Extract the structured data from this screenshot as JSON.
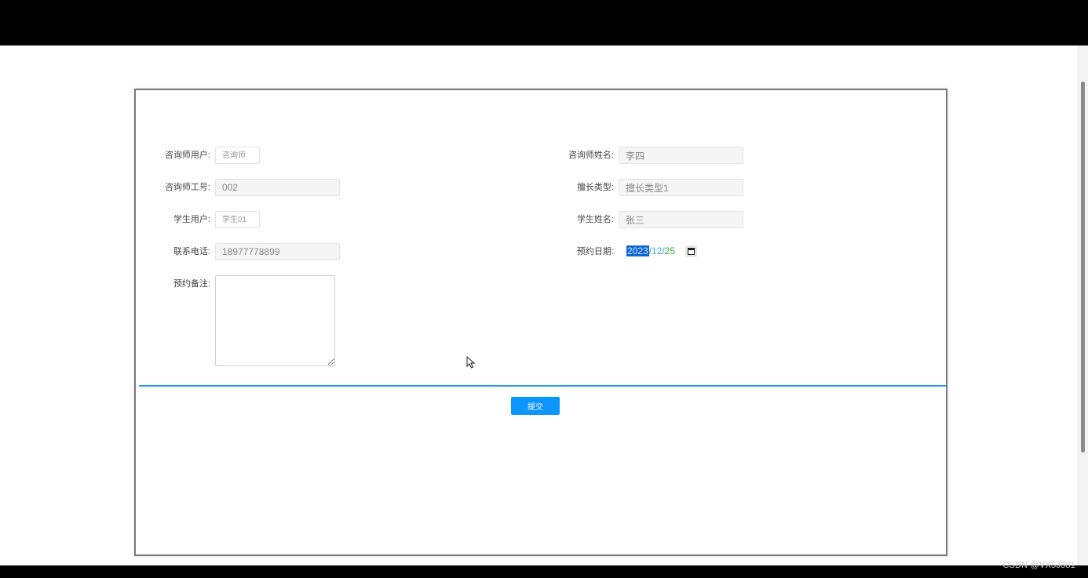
{
  "form": {
    "counselor_user": {
      "label": "咨询师用户:",
      "placeholder": "咨询师"
    },
    "counselor_name": {
      "label": "咨询师姓名:",
      "value": "李四"
    },
    "counselor_id": {
      "label": "咨询师工号:",
      "value": "002"
    },
    "specialty_type": {
      "label": "擅长类型:",
      "value": "擅长类型1"
    },
    "student_user": {
      "label": "学生用户:",
      "placeholder": "学生01"
    },
    "student_name": {
      "label": "学生姓名:",
      "value": "张三"
    },
    "phone": {
      "label": "联系电话:",
      "value": "18977778899"
    },
    "appointment_date": {
      "label": "预约日期:",
      "year": "2023",
      "month": "12",
      "day": "25",
      "separator": "/"
    },
    "appointment_notes": {
      "label": "预约备注:",
      "value": ""
    },
    "submit_label": "提交"
  },
  "footer": {
    "watermark": "CSDN @VX5J881"
  },
  "colors": {
    "accent": "#0a96fb",
    "divider": "#2aa1e6"
  }
}
